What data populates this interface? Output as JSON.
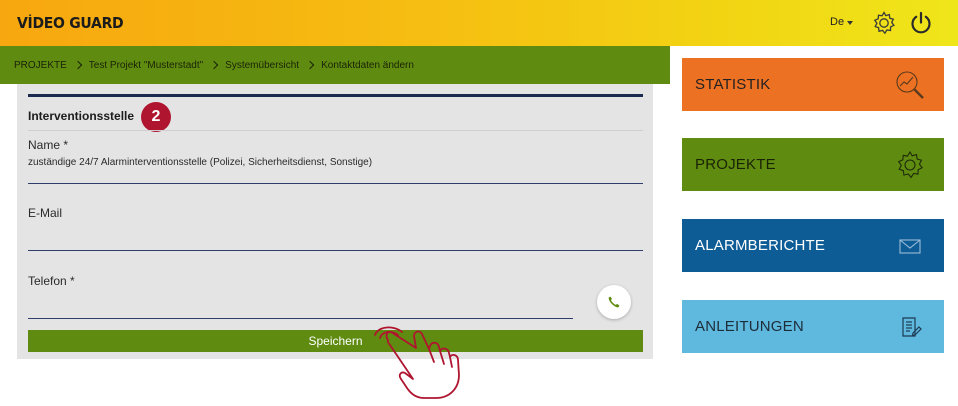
{
  "header": {
    "logo": "VİDEO GUARD",
    "language": "De",
    "colors": {
      "gradient_start": "#f7a70f",
      "gradient_end": "#efe61a"
    },
    "icons": [
      "gear-icon",
      "power-icon"
    ]
  },
  "breadcrumb": {
    "items": [
      "PROJEKTE",
      "Test Projekt \"Musterstadt\"",
      "Systemübersicht",
      "Kontaktdaten ändern"
    ],
    "color": "#5f8c10"
  },
  "form": {
    "section_title": "Interventionsstelle",
    "step_badge": "2",
    "fields": {
      "name": {
        "label": "Name *",
        "value": "zuständige 24/7 Alarminterventionsstelle (Polizei, Sicherheitsdienst, Sonstige)"
      },
      "email": {
        "label": "E-Mail",
        "value": ""
      },
      "phone": {
        "label": "Telefon *",
        "value": ""
      }
    },
    "save_label": "Speichern"
  },
  "tiles": [
    {
      "label": "STATISTIK",
      "icon": "magnifier-chart-icon",
      "color": "#ec7123"
    },
    {
      "label": "PROJEKTE",
      "icon": "gear-icon",
      "color": "#5f8c10"
    },
    {
      "label": "ALARMBERICHTE",
      "icon": "envelope-icon",
      "color": "#0e5c96"
    },
    {
      "label": "ANLEITUNGEN",
      "icon": "document-icon",
      "color": "#5fb8dd"
    }
  ]
}
